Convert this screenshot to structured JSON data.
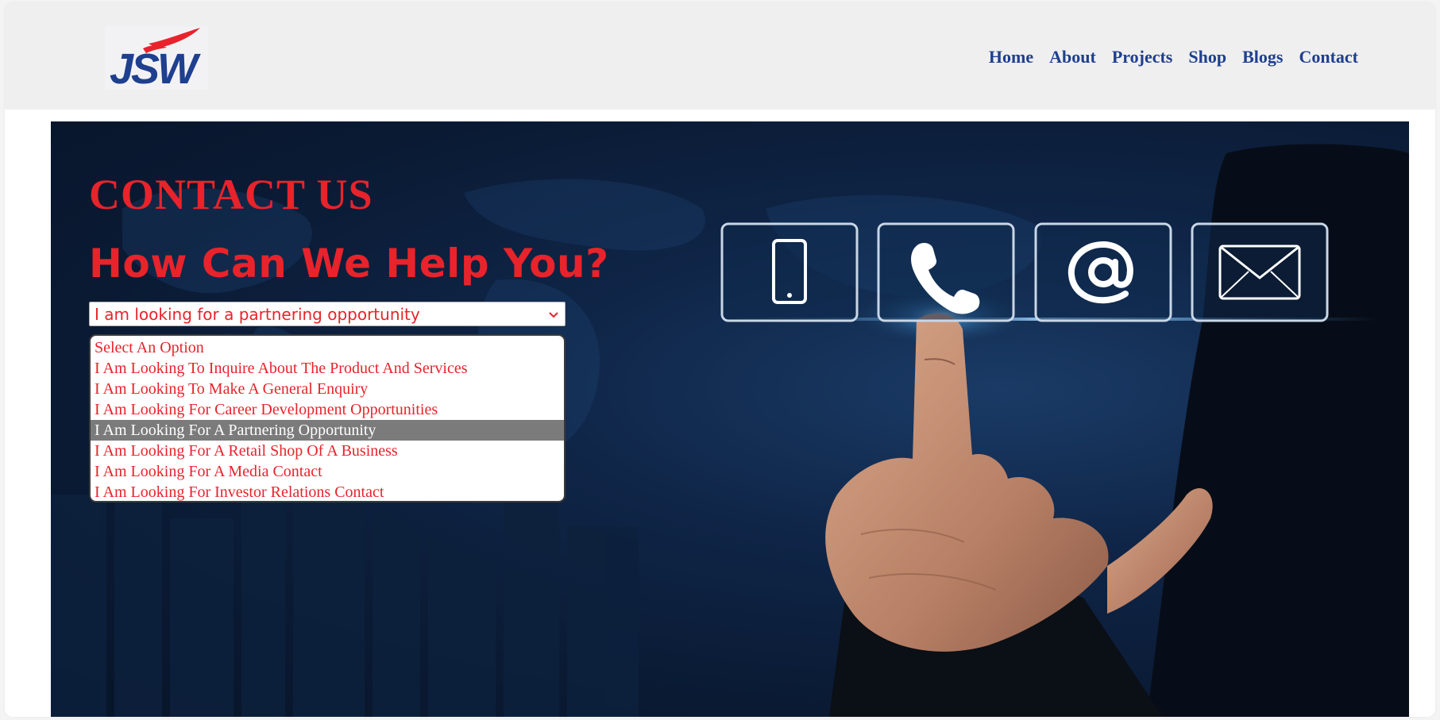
{
  "header": {
    "logo_text": "JSW",
    "nav": [
      "Home",
      "About",
      "Projects",
      "Shop",
      "Blogs",
      "Contact"
    ]
  },
  "hero": {
    "contact_title": "CONTACT US",
    "help_title": "How Can We Help You?",
    "select": {
      "value": "I am looking for a partnering opportunity",
      "options": [
        "Select An Option",
        "I Am Looking To Inquire About The Product And Services",
        "I Am Looking To Make A General Enquiry",
        "I Am Looking For Career Development Opportunities",
        "I Am Looking For A Partnering Opportunity",
        "I Am Looking For A Retail Shop Of A Business",
        "I Am Looking For A Media Contact",
        "I Am Looking For Investor Relations Contact"
      ],
      "selected_index": 4
    },
    "contact_icons": [
      "smartphone-icon",
      "phone-icon",
      "at-sign-icon",
      "envelope-icon"
    ]
  },
  "colors": {
    "accent_red": "#e8232b",
    "nav_blue": "#1f3f8f",
    "hero_navy": "#0a1a33",
    "highlight_gray": "#7b7b7b"
  }
}
